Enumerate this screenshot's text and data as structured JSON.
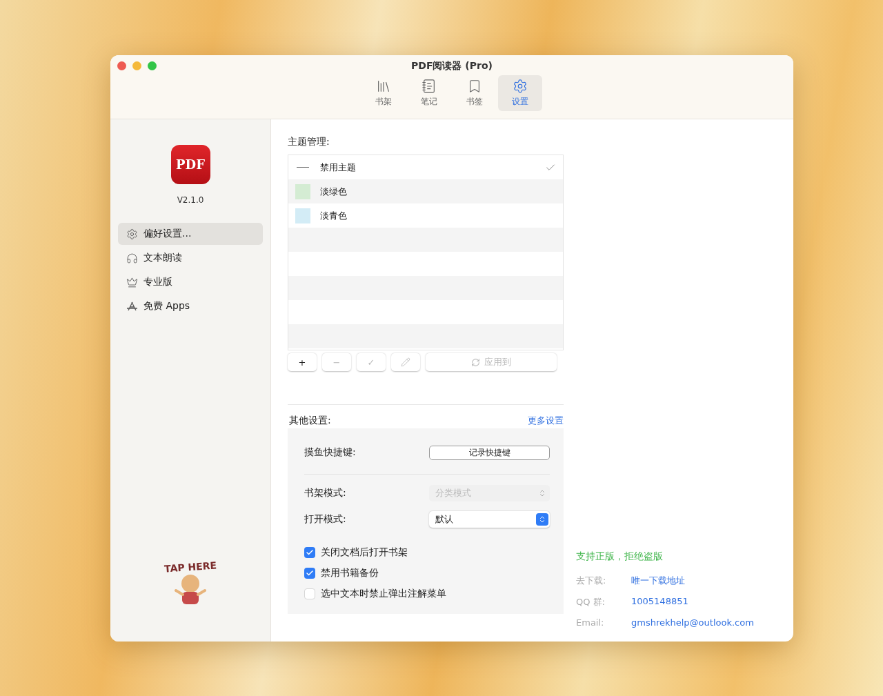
{
  "window": {
    "title": "PDF阅读器 (Pro)"
  },
  "tabs": [
    {
      "label": "书架",
      "selected": false
    },
    {
      "label": "笔记",
      "selected": false
    },
    {
      "label": "书签",
      "selected": false
    },
    {
      "label": "设置",
      "selected": true
    }
  ],
  "sidebar": {
    "logo": "PDF",
    "version": "V2.1.0",
    "items": [
      {
        "label": "偏好设置...",
        "selected": true
      },
      {
        "label": "文本朗读",
        "selected": false
      },
      {
        "label": "专业版",
        "selected": false
      },
      {
        "label": "免费 Apps",
        "selected": false
      }
    ],
    "sticker": "TAP HERE"
  },
  "themes": {
    "title": "主题管理:",
    "items": [
      {
        "kind": "none",
        "label": "禁用主题",
        "selected": true
      },
      {
        "kind": "swatch",
        "label": "淡绿色",
        "color": "#d4ecd3",
        "selected": false
      },
      {
        "kind": "swatch",
        "label": "淡青色",
        "color": "#d3ecf6",
        "selected": false
      }
    ],
    "toolbar": [
      {
        "kind": "add",
        "label": "+",
        "disabled": false
      },
      {
        "kind": "remove",
        "label": "−",
        "disabled": true
      },
      {
        "kind": "confirm",
        "label": "✓",
        "disabled": true
      },
      {
        "kind": "edit",
        "disabled": true
      },
      {
        "kind": "apply",
        "label": "应用到",
        "disabled": true
      }
    ]
  },
  "other": {
    "title": "其他设置:",
    "more_link": "更多设置",
    "shortcut": {
      "label": "摸鱼快捷键:",
      "button": "记录快捷键"
    },
    "selects": [
      {
        "label": "书架模式:",
        "value": "分类模式",
        "disabled": true
      },
      {
        "label": "打开模式:",
        "value": "默认",
        "disabled": false
      }
    ],
    "checkboxes": [
      {
        "label": "关闭文档后打开书架",
        "checked": true
      },
      {
        "label": "禁用书籍备份",
        "checked": true
      },
      {
        "label": "选中文本时禁止弹出注解菜单",
        "checked": false
      }
    ]
  },
  "info": {
    "slogan": "支持正版，拒绝盗版",
    "rows": [
      {
        "label": "去下载:",
        "value": "唯一下载地址"
      },
      {
        "label": "QQ 群:",
        "value": "1005148851"
      },
      {
        "label": "Email:",
        "value": "gmshrekhelp@outlook.com"
      }
    ]
  }
}
